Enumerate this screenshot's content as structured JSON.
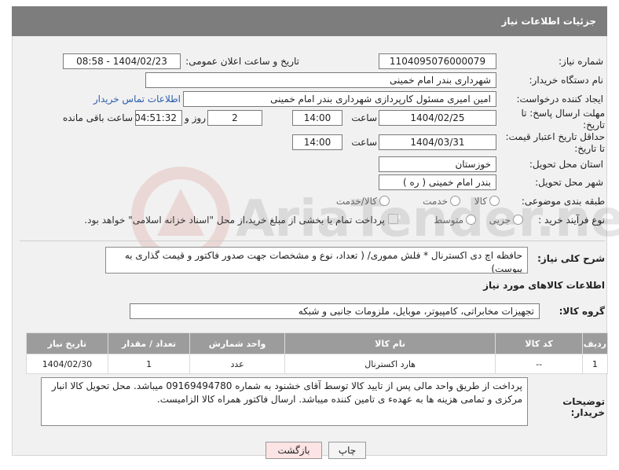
{
  "header": {
    "title": "جزئیات اطلاعات نیاز"
  },
  "watermark": {
    "text": "AriaTender.neT"
  },
  "fields": {
    "need_number": {
      "label": "شماره نیاز:",
      "value": "1104095076000079"
    },
    "announce_datetime": {
      "label": "تاریخ و ساعت اعلان عمومی:",
      "value": "1404/02/23 - 08:58"
    },
    "buyer_org": {
      "label": "نام دستگاه خریدار:",
      "value": "شهرداری بندر امام خمینی"
    },
    "requester": {
      "label": "ایجاد کننده درخواست:",
      "value": "امین امیری مسئول کارپردازی شهرداری بندر امام خمینی",
      "contact_link": "اطلاعات تماس خریدار"
    },
    "reply_deadline": {
      "label": "مهلت ارسال پاسخ: تا تاریخ:",
      "date": "1404/02/25",
      "time_label": "ساعت",
      "time": "14:00",
      "days": "2",
      "days_label": "روز و",
      "remaining": "04:51:32",
      "remaining_label": "ساعت باقی مانده"
    },
    "price_validity": {
      "label": "حداقل تاریخ اعتبار قیمت: تا تاریخ:",
      "date": "1404/03/31",
      "time_label": "ساعت",
      "time": "14:00"
    },
    "delivery_province": {
      "label": "استان محل تحویل:",
      "value": "خوزستان"
    },
    "delivery_city": {
      "label": "شهر محل تحویل:",
      "value": "بندر امام خمینی ( ره )"
    },
    "category": {
      "label": "طبقه بندی موضوعی:",
      "options": [
        "کالا",
        "خدمت",
        "کالا/خدمت"
      ]
    },
    "process_type": {
      "label": "نوع فرآیند خرید :",
      "options": [
        "جزیی",
        "متوسط"
      ],
      "note": "پرداخت تمام یا بخشی از مبلغ خرید،از محل \"اسناد خزانه اسلامی\" خواهد بود."
    }
  },
  "general_description": {
    "label": "شرح کلی نیاز:",
    "value": "حافظه اچ دی اکسترنال * فلش مموری/ ( تعداد، نوع و مشخصات جهت صدور فاکتور و قیمت گذاری به پیوست)"
  },
  "goods_section": {
    "title": "اطلاعات کالاهای مورد نیاز",
    "group_label": "گروه کالا:",
    "group_value": "تجهیزات مخابراتی، کامپیوتر، موبایل، ملزومات جانبی و شبکه"
  },
  "goods_table": {
    "headers": [
      "ردیف",
      "کد کالا",
      "نام کالا",
      "واحد شمارش",
      "تعداد / مقدار",
      "تاریخ نیاز"
    ],
    "rows": [
      [
        "1",
        "--",
        "هارد اکسترنال",
        "عدد",
        "1",
        "1404/02/30"
      ]
    ]
  },
  "buyer_notes": {
    "label": "توضیحات خریدار:",
    "value": "پرداخت از طریق واحد مالی پس از تایید کالا توسط آقای خشنود به شماره 09169494780 میباشد. محل تحویل کالا انبار مرکزی و تمامی هزینه ها به عهدهء ی تامین کننده میباشد. ارسال فاکتور همراه کالا الزامیست."
  },
  "buttons": {
    "print": "چاپ",
    "back": "بازگشت"
  },
  "colors": {
    "header_bg": "#7d7d7d",
    "table_header_bg": "#9c9c9c",
    "link": "#2a5db0",
    "back_button_bg": "#fde4e4"
  }
}
